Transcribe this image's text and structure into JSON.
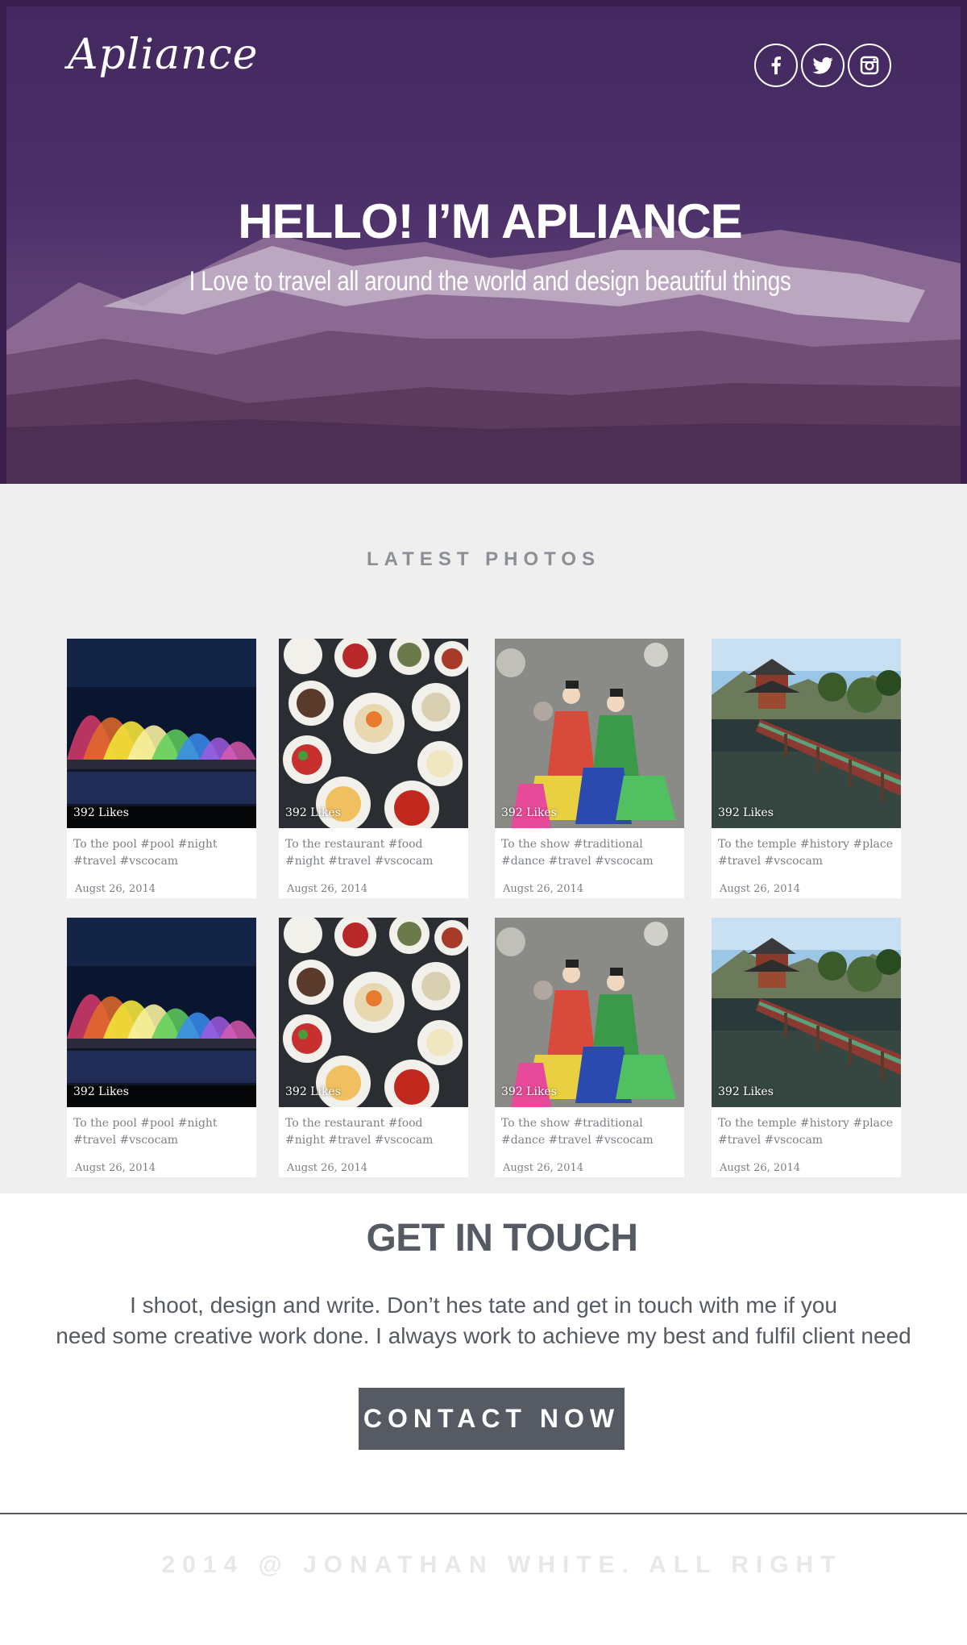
{
  "header": {
    "logo": "Apliance",
    "social": [
      {
        "name": "facebook-icon",
        "glyph": "f"
      },
      {
        "name": "twitter-icon"
      },
      {
        "name": "instagram-icon"
      }
    ],
    "title": "HELLO! I’M APLIANCE",
    "subtitle": "I  Love to  travel all around the world and design beautiful things"
  },
  "photos": {
    "title": "LATEST PHOTOS",
    "cards": [
      {
        "likes": "392 Likes",
        "caption": "To the pool #pool #night #travel #vscocam",
        "date": "Augst 26, 2014",
        "image": "bridge"
      },
      {
        "likes": "392 Likes",
        "caption": "To the restaurant #food #night #travel #vscocam",
        "date": "Augst 26, 2014",
        "image": "food"
      },
      {
        "likes": "392 Likes",
        "caption": "To the show #traditional #dance #travel #vscocam",
        "date": "Augst 26, 2014",
        "image": "dance"
      },
      {
        "likes": "392 Likes",
        "caption": "To the temple #history #place #travel #vscocam",
        "date": "Augst 26, 2014",
        "image": "temple"
      },
      {
        "likes": "392 Likes",
        "caption": "To the pool #pool #night #travel #vscocam",
        "date": "Augst 26, 2014",
        "image": "bridge"
      },
      {
        "likes": "392 Likes",
        "caption": "To the restaurant #food #night #travel #vscocam",
        "date": "Augst 26, 2014",
        "image": "food"
      },
      {
        "likes": "392 Likes",
        "caption": "To the show #traditional #dance #travel #vscocam",
        "date": "Augst 26, 2014",
        "image": "dance"
      },
      {
        "likes": "392 Likes",
        "caption": "To the temple #history #place #travel #vscocam",
        "date": "Augst 26, 2014",
        "image": "temple"
      }
    ]
  },
  "contact": {
    "title": "GET IN TOUCH",
    "line1": "I shoot, design and write. Don’t hes tate and get in touch with me if you",
    "line2": "need some creative work done. I always work to achieve my best and fulfil client need",
    "button": "CONTACT NOW"
  },
  "footer": {
    "text": "2014 @ JONATHAN WHITE. ALL RIGHT"
  },
  "colors": {
    "hero": "#4b2f68",
    "section_bg": "#efefef",
    "text_dark": "#555a63",
    "button_bg": "#555a63",
    "footer_text": "#e8e8ea"
  }
}
